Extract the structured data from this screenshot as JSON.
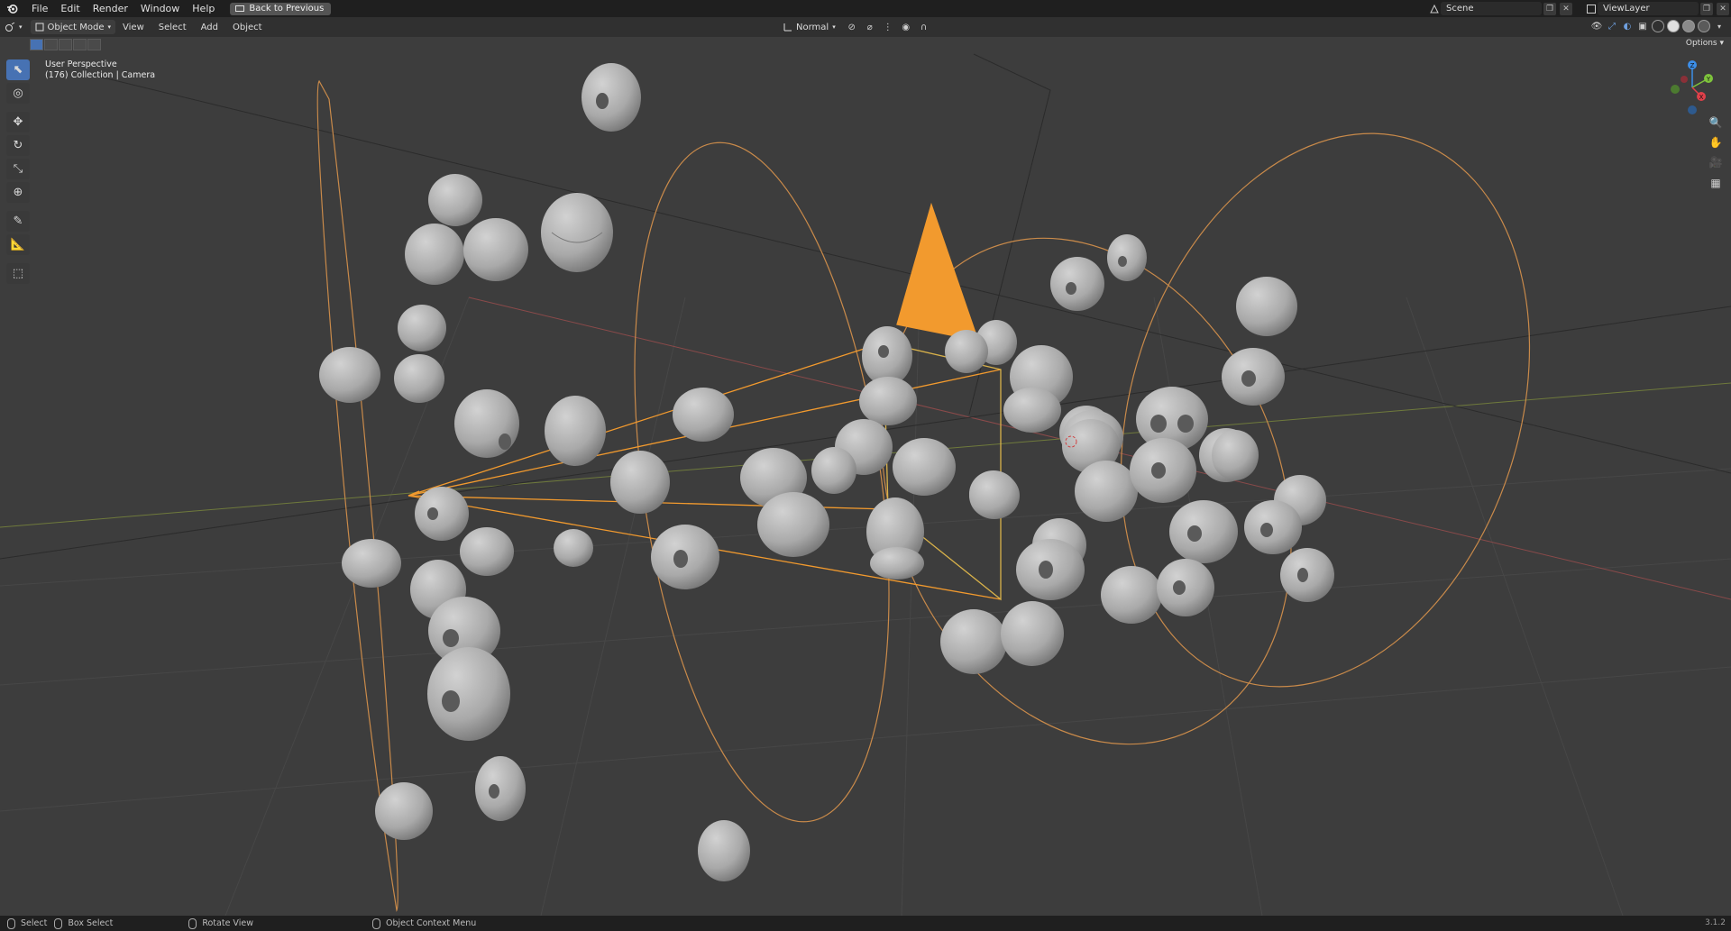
{
  "menubar": {
    "items": [
      "File",
      "Edit",
      "Render",
      "Window",
      "Help"
    ],
    "back_button": "Back to Previous",
    "scene_name": "Scene",
    "view_layer": "ViewLayer"
  },
  "viewport_header": {
    "mode": "Object Mode",
    "menus": [
      "View",
      "Select",
      "Add",
      "Object"
    ],
    "orientation": "Normal",
    "options_label": "Options"
  },
  "overlay": {
    "view_name": "User Perspective",
    "collection_info": "(176) Collection | Camera"
  },
  "gizmo": {
    "axes": [
      "Z",
      "Y",
      "X"
    ],
    "colors": {
      "x": "#e0404a",
      "y": "#7ec43c",
      "z": "#3c8ee8"
    }
  },
  "statusbar": {
    "items": [
      "Select",
      "Box Select",
      "Rotate View",
      "Object Context Menu"
    ],
    "version": "3.1.2"
  },
  "colors": {
    "accent": "#4772b3",
    "selection_orange": "#f29a2e",
    "viewport_bg": "#3d3d3d"
  }
}
